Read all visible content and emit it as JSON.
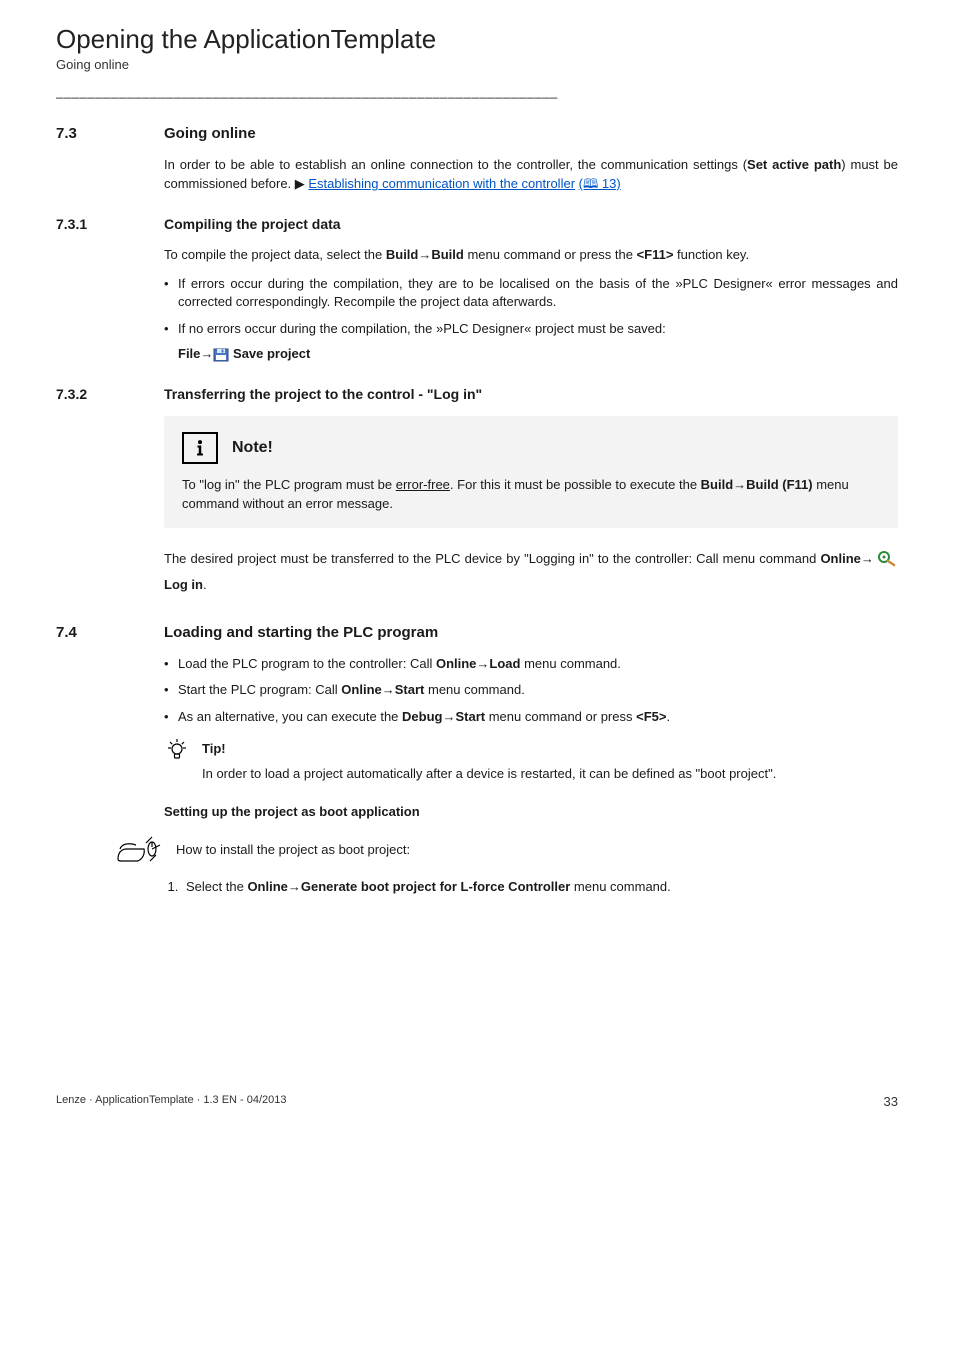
{
  "header": {
    "title": "Opening the ApplicationTemplate",
    "subtitle": "Going online"
  },
  "dashline": "_ _ _ _ _ _ _ _ _ _ _ _ _ _ _ _ _ _ _ _ _ _ _ _ _ _ _ _ _ _ _ _ _ _ _ _ _ _ _ _ _ _ _ _ _ _ _ _ _ _ _ _ _ _ _ _ _ _ _ _ _ _ _ _",
  "s73": {
    "num": "7.3",
    "title": "Going online",
    "para_a": "In order to be able to establish an online connection to the controller, the communication settings (",
    "bold_a": "Set active path",
    "para_b": ") must be commissioned before.  ▶ ",
    "link": "Establishing communication with the controller",
    "page_ref": "(🕮 13)"
  },
  "s731": {
    "num": "7.3.1",
    "title": "Compiling the project data",
    "para1a": "To compile the project data, select the ",
    "menu1": "Build→Build",
    "para1b": " menu command or press the ",
    "key1": "<F11>",
    "para1c": " function key.",
    "b1": "If errors occur during the compilation, they are to be localised on the basis of the »PLC Designer« error messages and corrected correspondingly. Recompile the project data afterwards.",
    "b2": "If no errors occur during the compilation, the »PLC Designer« project must be saved:",
    "file_a": "File→",
    "file_b": " Save project"
  },
  "s732": {
    "num": "7.3.2",
    "title": "Transferring the  project to the control - \"Log in\"",
    "note_title": "Note!",
    "note_a": "To \"log in\" the PLC program must be ",
    "note_ul": "error-free",
    "note_b": ". For this it must be possible to execute the ",
    "note_menu": "Build→Build (F11)",
    "note_c": " menu command without an error message.",
    "para2a": "The desired project must be transferred to the PLC device by \"Logging in\" to the controller: Call menu command ",
    "online_a": "Online→",
    "login": " Log in",
    "dot": "."
  },
  "s74": {
    "num": "7.4",
    "title": "Loading and starting the PLC program",
    "b1a": "Load the PLC program to the controller: Call ",
    "b1menu": "Online→Load",
    "b1b": " menu command.",
    "b2a": "Start the PLC program: Call ",
    "b2menu": "Online→Start",
    "b2b": " menu command.",
    "b3a": "As an alternative, you can execute the ",
    "b3menu": "Debug→Start",
    "b3b": " menu command or press ",
    "b3key": "<F5>",
    "b3c": ".",
    "tip_title": "Tip!",
    "tip_body": "In order to load a project automatically after a device is restarted, it can be defined as \"boot project\".",
    "boot_heading": "Setting up the project as boot application",
    "howto": "How to install the project as boot project:",
    "step1a": "Select the ",
    "step1menu": "Online→Generate boot project for L-force Controller",
    "step1b": " menu command."
  },
  "footer": {
    "left": "Lenze · ApplicationTemplate · 1.3 EN - 04/2013",
    "right": "33"
  }
}
